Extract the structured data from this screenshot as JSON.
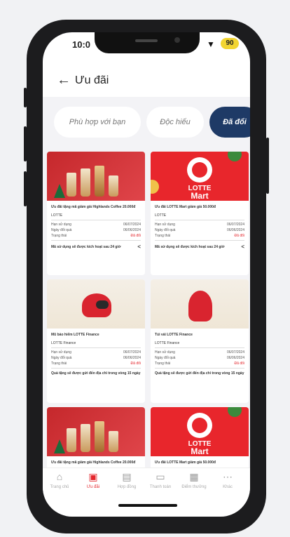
{
  "status_bar": {
    "time": "10:0",
    "wifi_icon": "wifi-icon",
    "battery_level": "90"
  },
  "header": {
    "title": "Ưu đãi",
    "back_icon": "arrow-left-icon"
  },
  "tabs": [
    {
      "label": "Phù hợp với bạn"
    },
    {
      "label": "Độc hiếu"
    },
    {
      "label": "Đã đổi"
    }
  ],
  "vouchers": [
    {
      "title": "Ưu đãi tặng mã giảm giá Highlands Coffee 20.000đ",
      "brand": "LOTTE",
      "row1": {
        "label": "Hạn sử dụng",
        "value": "06/07/2024"
      },
      "row2": {
        "label": "Ngày đổi quà",
        "value": "06/06/2024"
      },
      "row3": {
        "label": "Trạng thái",
        "value": "Đã đổi"
      },
      "note": "Mã sử dụng sẽ được kích hoạt sau 24 giờ"
    },
    {
      "title": "Ưu đãi LOTTE Mart giảm giá 50.000đ",
      "brand": "LOTTE",
      "row1": {
        "label": "Hạn sử dụng",
        "value": "06/07/2024"
      },
      "row2": {
        "label": "Ngày đổi quà",
        "value": "06/06/2024"
      },
      "row3": {
        "label": "Trạng thái",
        "value": "Đã đổi"
      },
      "note": "Mã sử dụng sẽ được kích hoạt sau 24 giờ"
    },
    {
      "title": "Mũ bảo hiểm LOTTE Finance",
      "brand": "LOTTE Finance",
      "row1": {
        "label": "Hạn sử dụng",
        "value": "06/07/2024"
      },
      "row2": {
        "label": "Ngày đổi quà",
        "value": "06/06/2024"
      },
      "row3": {
        "label": "Trạng thái",
        "value": "Đã đổi"
      },
      "note": "Quà tặng sẽ được gửi đến địa chỉ trong vòng 15 ngày"
    },
    {
      "title": "Túi vải LOTTE Finance",
      "brand": "LOTTE Finance",
      "row1": {
        "label": "Hạn sử dụng",
        "value": "06/07/2024"
      },
      "row2": {
        "label": "Ngày đổi quà",
        "value": "06/06/2024"
      },
      "row3": {
        "label": "Trạng thái",
        "value": "Đã đổi"
      },
      "note": "Quà tặng sẽ được gửi đến địa chỉ trong vòng 15 ngày"
    },
    {
      "title": "Ưu đãi tặng mã giảm giá Highlands Coffee 20.000đ"
    },
    {
      "title": "Ưu đãi LOTTE Mart giảm giá 50.000đ"
    }
  ],
  "mart_banner": {
    "line1": "LOTTE",
    "line2": "Mart"
  },
  "bottom_nav": [
    {
      "label": "Trang chủ",
      "icon": "home-icon"
    },
    {
      "label": "Ưu đãi",
      "icon": "gift-icon"
    },
    {
      "label": "Hợp đồng",
      "icon": "contract-icon"
    },
    {
      "label": "Thanh toán",
      "icon": "payment-icon"
    },
    {
      "label": "Điểm thưởng",
      "icon": "reward-icon"
    },
    {
      "label": "Khác",
      "icon": "more-icon"
    }
  ],
  "colors": {
    "primary_navy": "#1e3a66",
    "accent_red": "#e4262c",
    "battery": "#f2d531"
  }
}
